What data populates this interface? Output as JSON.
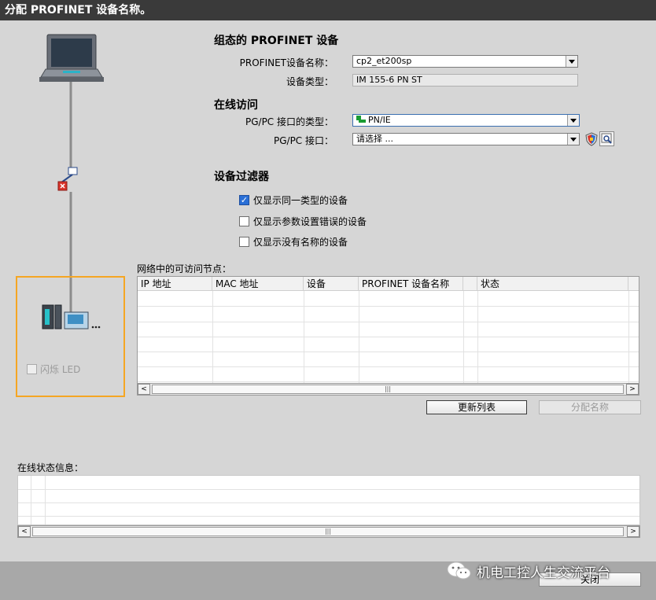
{
  "window": {
    "title": "分配 PROFINET 设备名称。"
  },
  "configured": {
    "heading": "组态的 PROFINET 设备",
    "name_label": "PROFINET设备名称：",
    "name_value": "cp2_et200sp",
    "type_label": "设备类型：",
    "type_value": "IM 155-6 PN ST"
  },
  "online": {
    "heading": "在线访问",
    "iface_type_label": "PG/PC 接口的类型：",
    "iface_type_value": "PN/IE",
    "iface_label": "PG/PC 接口：",
    "iface_value": "请选择 ..."
  },
  "filter": {
    "heading": "设备过滤器",
    "options": [
      {
        "label": "仅显示同一类型的设备",
        "checked": true
      },
      {
        "label": "仅显示参数设置错误的设备",
        "checked": false
      },
      {
        "label": "仅显示没有名称的设备",
        "checked": false
      }
    ]
  },
  "device_panel": {
    "flash_led_label": "闪烁 LED"
  },
  "nodes": {
    "caption": "网络中的可访问节点：",
    "columns": [
      "IP 地址",
      "MAC 地址",
      "设备",
      "PROFINET 设备名称",
      "状态"
    ]
  },
  "buttons": {
    "update_list": "更新列表",
    "assign_name": "分配名称",
    "close": "关闭"
  },
  "status": {
    "caption": "在线状态信息："
  },
  "watermark": {
    "text": "机电工控人生交流平台"
  },
  "colors": {
    "highlight_border": "#f5a623",
    "title_bg": "#3a3a3a",
    "checkbox_checked": "#2a6fd6"
  }
}
